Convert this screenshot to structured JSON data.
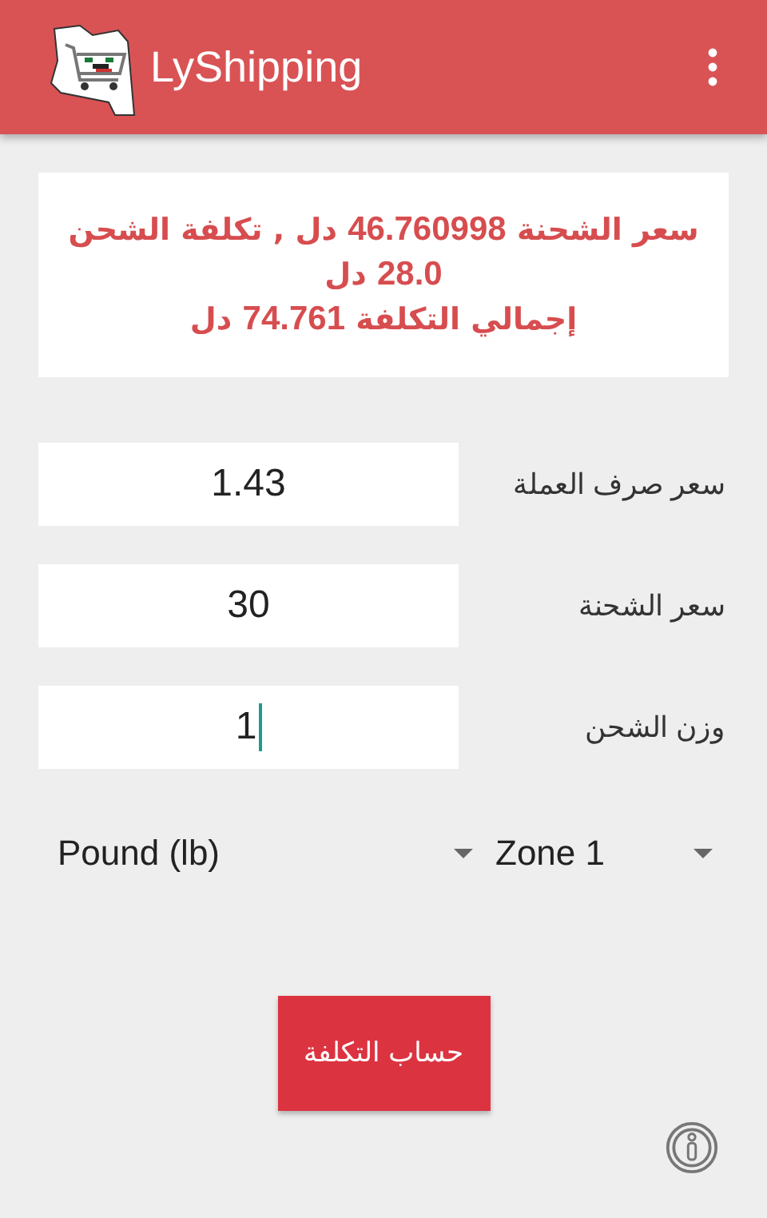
{
  "app_bar": {
    "title": "LyShipping"
  },
  "result": {
    "lines": [
      "سعر الشحنة **46.760998** دل , تكلفة الشحن **28.0** دل",
      "إجمالي التكلفة **74.761** دل"
    ]
  },
  "fields": [
    {
      "label": "سعر صرف العملة",
      "value": "1.43",
      "focused": false
    },
    {
      "label": "سعر الشحنة",
      "value": "30",
      "focused": false
    },
    {
      "label": "وزن الشحن",
      "value": "1",
      "focused": true
    }
  ],
  "unit_dropdown": {
    "value": "Pound (lb)"
  },
  "zone_dropdown": {
    "value": "Zone 1"
  },
  "calculate_button": {
    "label": "حساب التكلفة"
  }
}
